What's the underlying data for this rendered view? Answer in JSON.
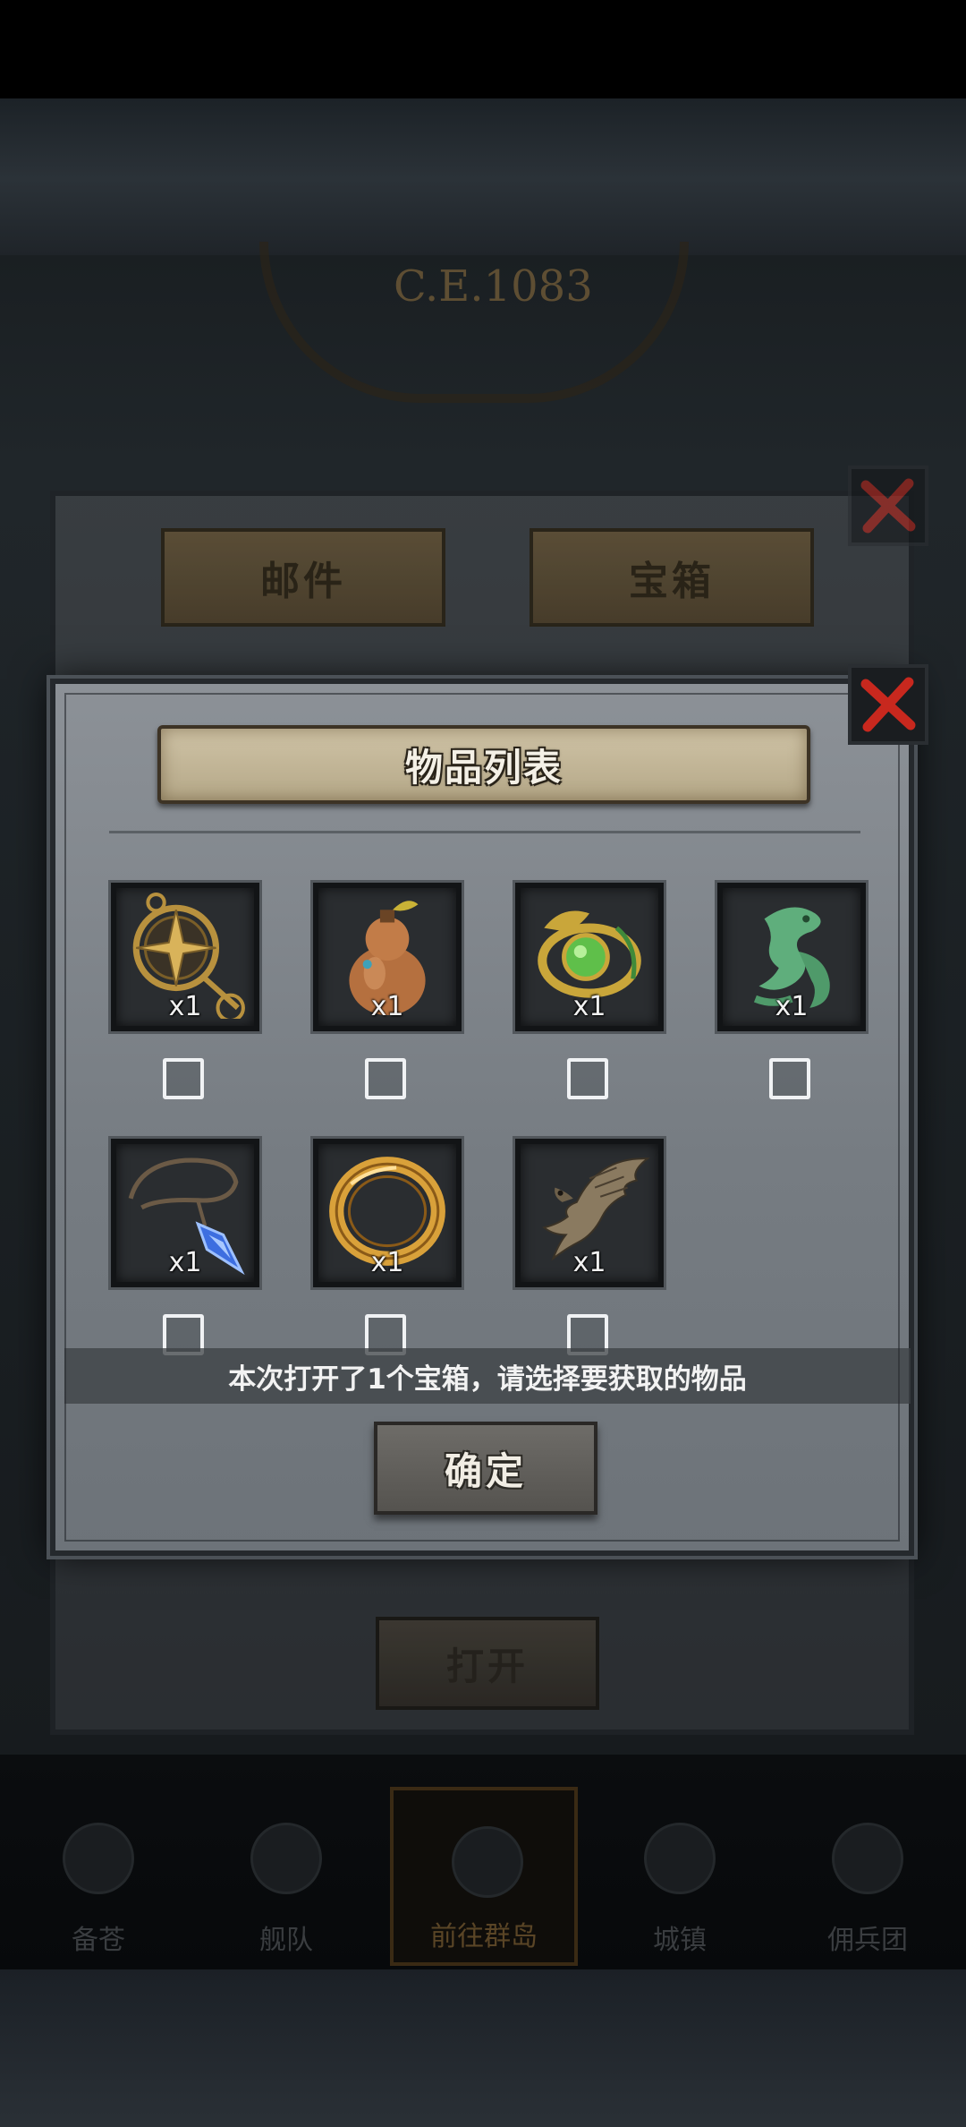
{
  "background": {
    "era_text": "C.E.1083",
    "nav": [
      {
        "label": "备苍"
      },
      {
        "label": "舰队"
      },
      {
        "label": "前往群岛"
      },
      {
        "label": "城镇"
      },
      {
        "label": "佣兵团"
      }
    ]
  },
  "mailbox": {
    "tabs": {
      "mail": "邮件",
      "chest": "宝箱"
    },
    "open_button": "打开"
  },
  "item_dialog": {
    "title": "物品列表",
    "items": [
      {
        "icon": "compass-icon",
        "qty": "x1"
      },
      {
        "icon": "gourd-icon",
        "qty": "x1"
      },
      {
        "icon": "jade-ring-icon",
        "qty": "x1"
      },
      {
        "icon": "jade-dragon-icon",
        "qty": "x1"
      },
      {
        "icon": "crystal-pendant-icon",
        "qty": "x1"
      },
      {
        "icon": "gold-ring-icon",
        "qty": "x1"
      },
      {
        "icon": "eagle-statue-icon",
        "qty": "x1"
      }
    ],
    "notice": "本次打开了1个宝箱，请选择要获取的物品",
    "confirm_button": "确定"
  },
  "colors": {
    "banner": "#c6b998",
    "dialog": "#80868c",
    "close_red": "#c8281e"
  }
}
